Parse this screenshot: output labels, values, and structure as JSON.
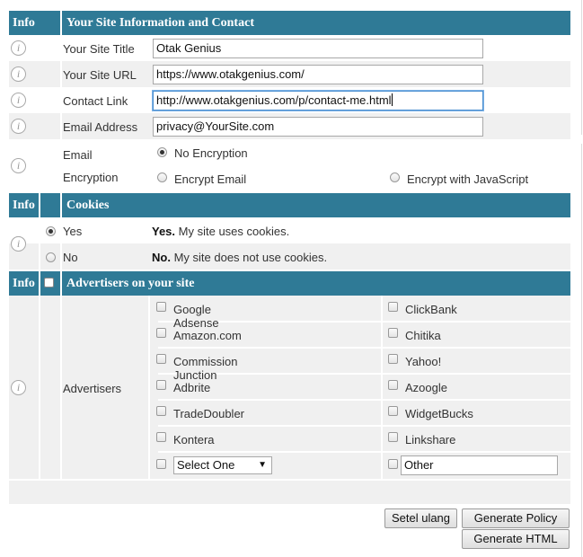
{
  "site_info": {
    "header_info": "Info",
    "header_title": "Your Site Information and Contact",
    "site_title_label": "Your Site Title",
    "site_title_value": "Otak Genius",
    "site_url_label": "Your Site URL",
    "site_url_value": "https://www.otakgenius.com/",
    "contact_link_label": "Contact Link",
    "contact_link_value": "http://www.otakgenius.com/p/contact-me.html",
    "email_label": "Email Address",
    "email_value": "privacy@YourSite.com",
    "encryption_label_1": "Email",
    "encryption_label_2": "Encryption",
    "encryption_options": [
      "No Encryption",
      "Encrypt Email",
      "Encrypt with JavaScript"
    ],
    "encryption_selected": "No Encryption"
  },
  "cookies": {
    "header_info": "Info",
    "header_title": "Cookies",
    "yes_label": "Yes",
    "yes_bold": "Yes.",
    "yes_desc": "My site uses cookies.",
    "no_label": "No",
    "no_bold": "No.",
    "no_desc": "My site does not use cookies.",
    "selected": "Yes"
  },
  "advertisers": {
    "header_info": "Info",
    "header_title": "Advertisers on your site",
    "row_label": "Advertisers",
    "left": [
      "Google Adsense",
      "Amazon.com",
      "Commission Junction",
      "Adbrite",
      "TradeDoubler",
      "Kontera"
    ],
    "right": [
      "ClickBank",
      "Chitika",
      "Yahoo!",
      "Azoogle",
      "WidgetBucks",
      "Linkshare"
    ],
    "select_value": "Select One",
    "other_value": "Other"
  },
  "buttons": {
    "reset": "Setel ulang",
    "generate_policy": "Generate Policy",
    "generate_html": "Generate HTML"
  },
  "icons": {
    "info": "info-icon",
    "select_arrow": "▼"
  },
  "colors": {
    "header_bg": "#2f7a96",
    "row_shade": "#f0f0f0"
  }
}
